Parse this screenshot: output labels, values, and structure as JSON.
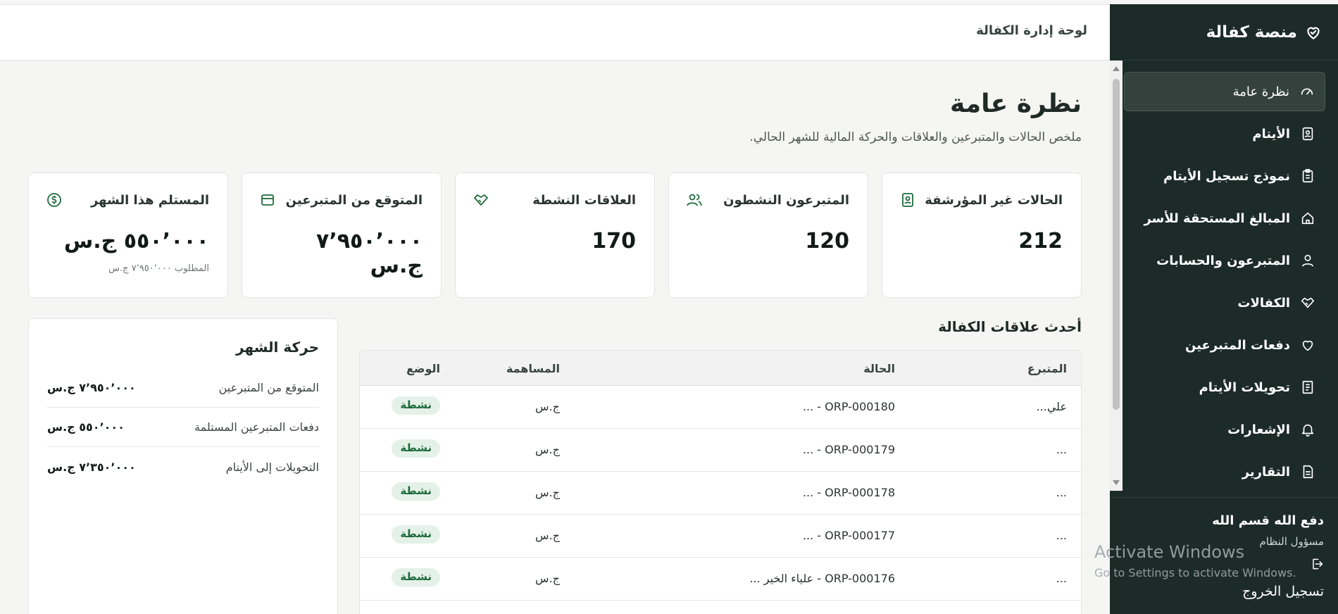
{
  "app": {
    "brand": "منصة كفالة",
    "header_title": "لوحة إدارة الكفالة"
  },
  "sidebar": {
    "items": [
      {
        "label": "نظرة عامة",
        "icon": "gauge-icon",
        "active": true
      },
      {
        "label": "الأيتام",
        "icon": "id-card-icon"
      },
      {
        "label": "نموذج تسجيل الأيتام",
        "icon": "clipboard-icon"
      },
      {
        "label": "المبالغ المستحقة للأسر",
        "icon": "home-icon"
      },
      {
        "label": "المتبرعون والحسابات",
        "icon": "user-icon"
      },
      {
        "label": "الكفالات",
        "icon": "handshake-icon"
      },
      {
        "label": "دفعات المتبرعين",
        "icon": "heart-hand-icon"
      },
      {
        "label": "تحويلات الأيتام",
        "icon": "receipt-icon"
      },
      {
        "label": "الإشعارات",
        "icon": "bell-icon"
      },
      {
        "label": "التقارير",
        "icon": "report-icon"
      }
    ],
    "user": {
      "name": "دفع الله قسم الله",
      "role": "مسؤول النظام",
      "logout": "تسجيل الخروج"
    }
  },
  "main": {
    "title": "نظرة عامة",
    "subtitle": "ملخص الحالات والمتبرعين والعلاقات والحركة المالية للشهر الحالي.",
    "kpis": [
      {
        "label": "الحالات غير المؤرشفة",
        "value": "212",
        "icon": "id-badge-icon"
      },
      {
        "label": "المتبرعون النشطون",
        "value": "120",
        "icon": "users-icon"
      },
      {
        "label": "العلاقات النشطة",
        "value": "170",
        "icon": "handshake-icon"
      },
      {
        "label": "المتوقع من المتبرعين",
        "value": "٧٬٩٥٠٬٠٠٠ ج.س",
        "icon": "wallet-icon"
      },
      {
        "label": "المستلم هذا الشهر",
        "value": "٥٥٠٬٠٠٠ ج.س",
        "note": "المطلوب ٧٬٩٥٠٬٠٠٠ ج.س",
        "icon": "dollar-circle-icon"
      }
    ],
    "relations": {
      "title": "أحدث علاقات الكفالة",
      "columns": {
        "donor": "المتبرع",
        "case": "الحالة",
        "amount": "المساهمة",
        "status": "الوضع"
      },
      "rows": [
        {
          "donor": "علي...",
          "case": "ORP-000180 - ...",
          "amount": "ج.س",
          "status": "نشطة"
        },
        {
          "donor": "...",
          "case": "ORP-000179 - ...",
          "amount": "ج.س",
          "status": "نشطة"
        },
        {
          "donor": "...",
          "case": "ORP-000178 - ...",
          "amount": "ج.س",
          "status": "نشطة"
        },
        {
          "donor": "...",
          "case": "ORP-000177 - ...",
          "amount": "ج.س",
          "status": "نشطة"
        },
        {
          "donor": "...",
          "case": "ORP-000176 - علياء الخير ...",
          "amount": "ج.س",
          "status": "نشطة"
        }
      ]
    },
    "month_activity": {
      "title": "حركة الشهر",
      "rows": [
        {
          "label": "المتوقع من المتبرعين",
          "value": "٧٬٩٥٠٬٠٠٠ ج.س"
        },
        {
          "label": "دفعات المتبرعين المستلمة",
          "value": "٥٥٠٬٠٠٠ ج.س"
        },
        {
          "label": "التحويلات إلى الأيتام",
          "value": "٧٬٣٥٠٬٠٠٠ ج.س"
        }
      ]
    }
  },
  "watermark": {
    "title": "Activate Windows",
    "subtitle": "Go to Settings to activate Windows."
  },
  "colors": {
    "sidebar_bg": "#1c2b27",
    "badge_bg": "#e4f1e8",
    "badge_text": "#1d6b3c"
  }
}
